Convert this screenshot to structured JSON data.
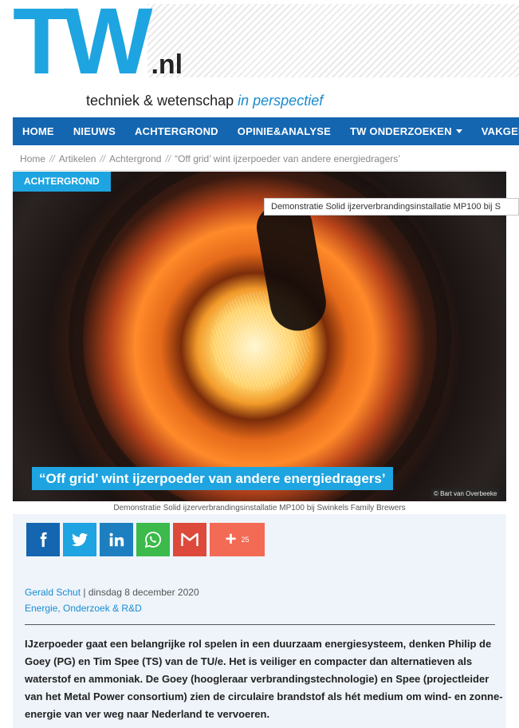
{
  "site": {
    "logo_main": "TW",
    "logo_suffix": ".nl",
    "tagline_plain": "techniek & wetenschap",
    "tagline_accent": "in perspectief",
    "brand_blue": "#1ea4e0",
    "nav_blue": "#1466b1"
  },
  "nav": {
    "items": [
      {
        "label": "HOME"
      },
      {
        "label": "NIEUWS"
      },
      {
        "label": "ACHTERGROND"
      },
      {
        "label": "OPINIE&ANALYSE"
      },
      {
        "label": "TW ONDERZOEKEN",
        "has_dropdown": true
      },
      {
        "label": "VAKGEB"
      }
    ]
  },
  "breadcrumb": {
    "separator": "//",
    "items": [
      "Home",
      "Artikelen",
      "Achtergrond",
      "“Off grid’ wint ijzerpoeder van andere energiedragers’"
    ]
  },
  "hero": {
    "category_badge": "ACHTERGROND",
    "image_tooltip": "Demonstratie Solid ijzerverbrandingsinstallatie MP100 bij S",
    "title": "“Off grid’ wint ijzerpoeder van andere energiedragers’",
    "photo_credit": "© Bart van Overbeeke",
    "caption": "Demonstratie Solid ijzerverbrandingsinstallatie MP100 bij Swinkels Family Brewers"
  },
  "share": {
    "buttons": [
      {
        "icon": "facebook-icon"
      },
      {
        "icon": "twitter-icon"
      },
      {
        "icon": "linkedin-icon"
      },
      {
        "icon": "whatsapp-icon"
      },
      {
        "icon": "gmail-icon"
      }
    ],
    "more_count": "25"
  },
  "article": {
    "author": "Gerald Schut",
    "meta_sep": " | ",
    "date": "dinsdag 8 december 2020",
    "categories": "Energie, Onderzoek & R&D",
    "lead": "IJzerpoeder gaat een belangrijke rol spelen in een duurzaam energiesysteem, denken Philip de Goey (PG) en Tim Spee (TS) van de TU/e. Het is veiliger en compacter dan alternatieven als waterstof en ammoniak. De Goey (hoogleraar verbrandingstechnologie) en Spee (projectleider van het Metal Power consortium) zien de circulaire brandstof als hét medium om wind- en zonne-energie van ver weg naar Nederland te vervoeren."
  }
}
